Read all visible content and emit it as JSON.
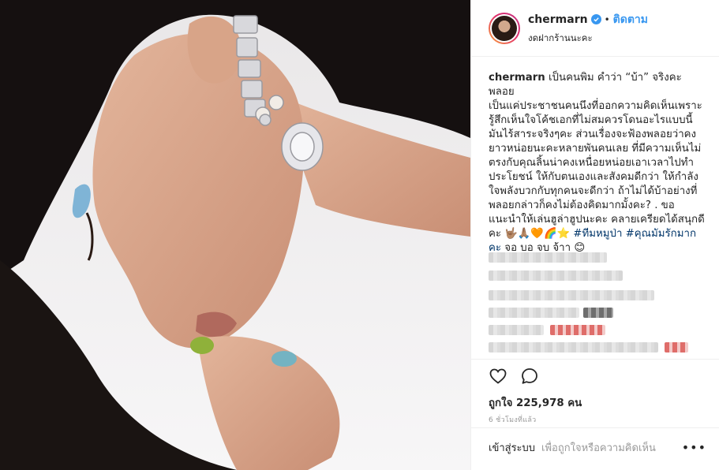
{
  "header": {
    "username": "chermarn",
    "separator": "•",
    "follow_label": "ติดตาม",
    "location": "งดฝากร้านนะคะ"
  },
  "caption": {
    "username": "chermarn",
    "line1": "เป็นคนพิม คำว่า “บ้า” จริงคะ พลอย",
    "line2": "เป็นแค่ประชาชนคนนึงที่ออกความคิดเห็นเพราะ",
    "line3": "รู้สึกเห็นใจโค้ชเอกที่ไม่สมควรโดนอะไรแบบนี้",
    "line4": "มันไร้สาระจริงๆคะ ส่วนเรื่องจะฟ้องพลอยว่าคง",
    "line5": "ยาวหน่อยนะคะหลายพันคนเลย ที่มีความเห็นไม่",
    "line6": "ตรงกับคุณลิ้นน่าคงเหนื่อยหน่อยเอาเวลาไปทำ",
    "line7": "ประโยชน์ ให้กับตนเองและสังคมดีกว่า ให้กำลัง",
    "line8": "ใจพลังบวกกับทุกคนจะดีกว่า ถ้าไม่ได้บ้าอย่างที่",
    "line9": "พลอยกล่าวก็คงไม่ต้องคิดมากมั้งคะ? . ขอ",
    "line10": "แนะนำให้เล่นฮูล่าฮูปนะคะ คลายเครียดได้สนุกดี",
    "line11_prefix": "คะ",
    "emojis": "🤟🏽🙏🏽🧡🌈⭐️",
    "hashtag1": "#ทีมหมูป่า",
    "hashtag2": "#คุณมัมรักมาก",
    "line12_prefix": "คะ",
    "line12_text": "จอ บอ จบ จ้าา",
    "line12_emoji": "😊"
  },
  "stats": {
    "likes_label": "ถูกใจ 225,978 คน",
    "time_ago": "6 ชั่วโมงที่แล้ว"
  },
  "comment_bar": {
    "login_label": "เข้าสู่ระบบ",
    "hint": "เพื่อถูกใจหรือความคิดเห็น",
    "more": "•••"
  },
  "colors": {
    "accent": "#3897f0",
    "hashtag": "#003569"
  },
  "icons": {
    "like": "heart-icon",
    "comment": "comment-icon",
    "verified": "verified-badge-icon",
    "more": "more-options-icon"
  }
}
